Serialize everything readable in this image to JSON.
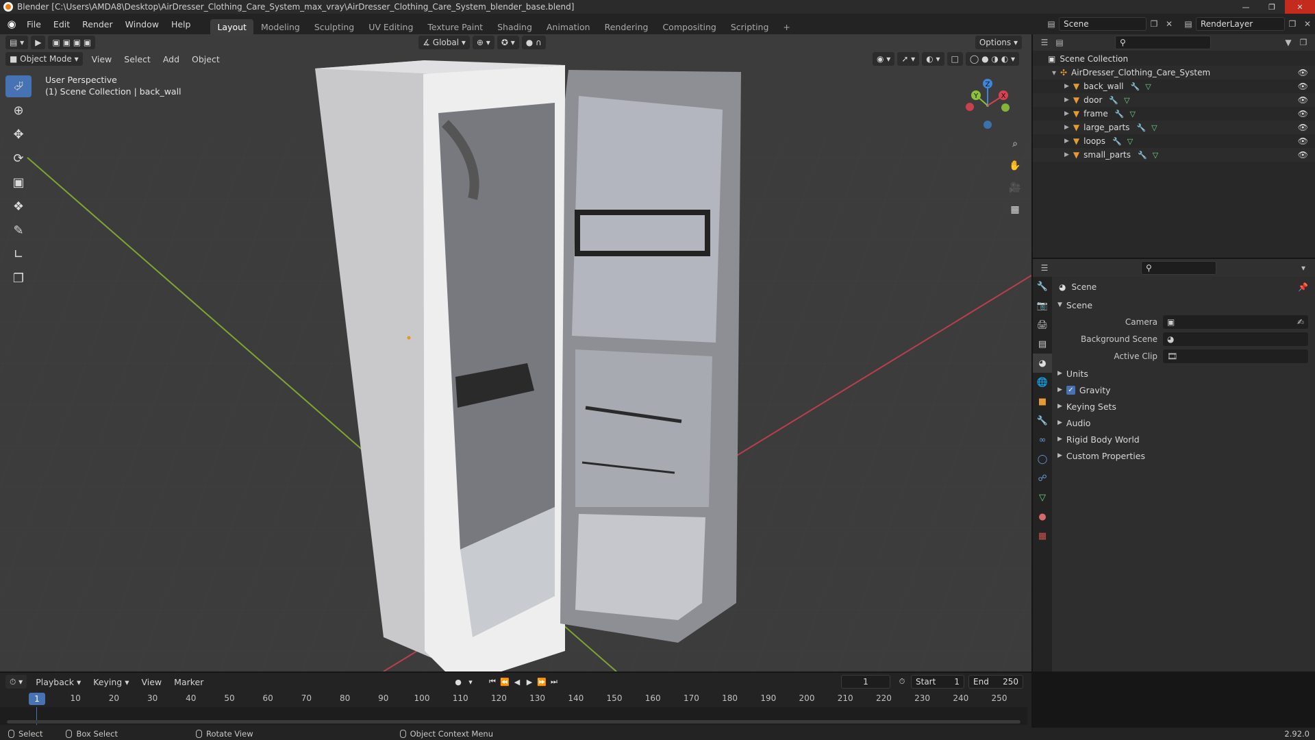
{
  "window": {
    "title": "Blender [C:\\Users\\AMDA8\\Desktop\\AirDresser_Clothing_Care_System_max_vray\\AirDresser_Clothing_Care_System_blender_base.blend]"
  },
  "menubar": {
    "items": [
      "File",
      "Edit",
      "Render",
      "Window",
      "Help"
    ],
    "workspaces": [
      "Layout",
      "Modeling",
      "Sculpting",
      "UV Editing",
      "Texture Paint",
      "Shading",
      "Animation",
      "Rendering",
      "Compositing",
      "Scripting"
    ],
    "active_workspace": "Layout",
    "scene": "Scene",
    "view_layer": "RenderLayer"
  },
  "viewport": {
    "mode": "Object Mode",
    "menus": [
      "View",
      "Select",
      "Add",
      "Object"
    ],
    "transform_orientation": "Global",
    "options_label": "Options",
    "overlay_title": "User Perspective",
    "overlay_subtitle": "(1) Scene Collection | back_wall",
    "gizmo_axes": {
      "x": "X",
      "y": "Y",
      "z": "Z"
    }
  },
  "outliner": {
    "root": "Scene Collection",
    "collection": "AirDresser_Clothing_Care_System",
    "objects": [
      "back_wall",
      "door",
      "frame",
      "large_parts",
      "loops",
      "small_parts"
    ]
  },
  "properties": {
    "header": "Scene",
    "panel": "Scene",
    "fields": [
      {
        "label": "Camera"
      },
      {
        "label": "Background Scene"
      },
      {
        "label": "Active Clip"
      }
    ],
    "sections": [
      "Units",
      "Gravity",
      "Keying Sets",
      "Audio",
      "Rigid Body World",
      "Custom Properties"
    ]
  },
  "timeline": {
    "menus": [
      "Playback",
      "Keying",
      "View",
      "Marker"
    ],
    "current_frame": "1",
    "start_label": "Start",
    "start": "1",
    "end_label": "End",
    "end": "250",
    "ticks": [
      "10",
      "20",
      "30",
      "40",
      "50",
      "60",
      "70",
      "80",
      "90",
      "100",
      "110",
      "120",
      "130",
      "140",
      "150",
      "160",
      "170",
      "180",
      "190",
      "200",
      "210",
      "220",
      "230",
      "240",
      "250"
    ]
  },
  "statusbar": {
    "items": [
      "Select",
      "Box Select",
      "Rotate View",
      "Object Context Menu"
    ],
    "version": "2.92.0"
  },
  "colors": {
    "accent": "#4772b3",
    "object_icon": "#e59a33",
    "viewport_bg": "#3c3c3c",
    "axis_x": "#d6434f",
    "axis_y": "#8ec13a",
    "axis_z": "#3b87dd"
  }
}
